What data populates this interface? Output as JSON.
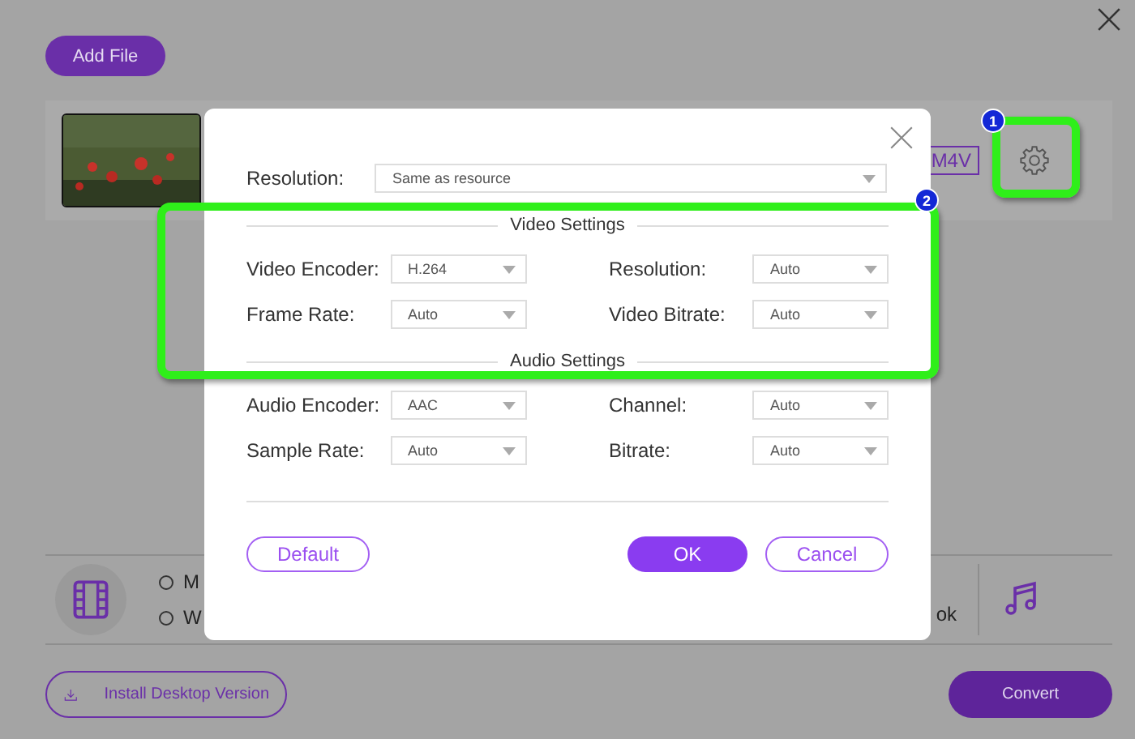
{
  "page": {
    "add_file_button": "Add File",
    "format_tag": "M4V",
    "video_formats": [
      {
        "label": "M",
        "selected": false
      },
      {
        "label": "W",
        "selected": false
      }
    ],
    "audio_format_fragment": "ok",
    "install_button": "Install Desktop Version",
    "convert_button": "Convert"
  },
  "dialog": {
    "resolution": {
      "label": "Resolution:",
      "value": "Same as resource"
    },
    "sections": [
      {
        "title": "Video Settings",
        "fields": [
          {
            "label": "Video Encoder:",
            "value": "H.264"
          },
          {
            "label": "Resolution:",
            "value": "Auto"
          },
          {
            "label": "Frame Rate:",
            "value": "Auto"
          },
          {
            "label": "Video Bitrate:",
            "value": "Auto"
          }
        ]
      },
      {
        "title": "Audio Settings",
        "fields": [
          {
            "label": "Audio Encoder:",
            "value": "AAC"
          },
          {
            "label": "Channel:",
            "value": "Auto"
          },
          {
            "label": "Sample Rate:",
            "value": "Auto"
          },
          {
            "label": "Bitrate:",
            "value": "Auto"
          }
        ]
      }
    ],
    "buttons": [
      {
        "label": "Default",
        "kind": "outline"
      },
      {
        "label": "OK",
        "kind": "primary"
      },
      {
        "label": "Cancel",
        "kind": "outline"
      }
    ]
  },
  "annotations": [
    {
      "number": "1"
    },
    {
      "number": "2"
    }
  ]
}
